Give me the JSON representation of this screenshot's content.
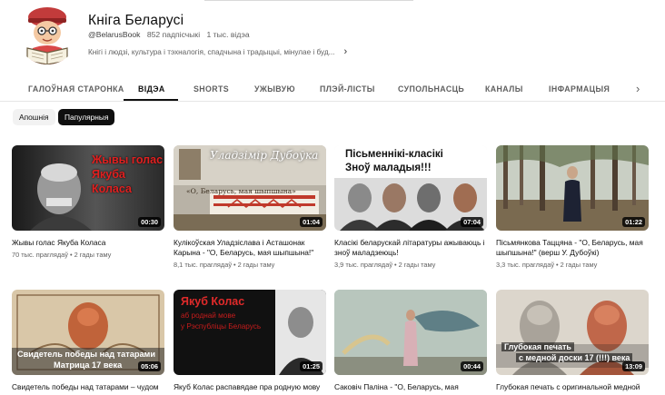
{
  "channel": {
    "name": "Кніга Беларусі",
    "handle": "@BelarusBook",
    "subscribers": "852 падпісчыкі",
    "videos_count": "1 тыс. відэа",
    "description": "Кнігі і людзі, культура і тэхналогія, спадчына і традыцыі, мінулае і буд..."
  },
  "tabs": [
    {
      "label": "ГАЛОЎНАЯ СТАРОНКА"
    },
    {
      "label": "ВІДЭА"
    },
    {
      "label": "SHORTS"
    },
    {
      "label": "УЖЫВУЮ"
    },
    {
      "label": "ПЛЭЙ-ЛІСТЫ"
    },
    {
      "label": "СУПОЛЬНАСЦЬ"
    },
    {
      "label": "КАНАЛЫ"
    },
    {
      "label": "ІНФАРМАЦЫЯ"
    }
  ],
  "active_tab": "ВІДЭА",
  "chips": {
    "newest": "Апошнія",
    "popular": "Папулярныя",
    "selected": "Папулярныя"
  },
  "videos": [
    {
      "title": "Жывы голас Якуба Коласа",
      "views": "70 тыс. праглядаў",
      "age": "2 гады таму",
      "duration": "00:30",
      "thumb_text": [
        "Жывы голас",
        "Якуба Коласа"
      ]
    },
    {
      "title": "Кулікоўская Уладзіслава і Асташонак Карына - \"О, Беларусь, мая шыпшына!\"",
      "views": "8,1 тыс. праглядаў",
      "age": "2 гады таму",
      "duration": "01:04",
      "thumb_text": [
        "Уладзімір Дубоўка",
        "«О, Беларусь, мая шыпшына»"
      ]
    },
    {
      "title": "Класікі беларускай літаратуры ажываюць і зноў маладзеюць!",
      "views": "3,9 тыс. праглядаў",
      "age": "2 гады таму",
      "duration": "07:04",
      "thumb_text": [
        "Пісьменнікі-класікі",
        "Зноў маладыя!!!"
      ]
    },
    {
      "title": "Пісьмянкова Таццяна - \"О, Беларусь, мая шыпшына!\" (верш У. Дубоўкі)",
      "views": "3,3 тыс. праглядаў",
      "age": "2 гады таму",
      "duration": "01:22",
      "thumb_text": []
    },
    {
      "title": "Свидетель победы над татарами – чудом уцелевшая",
      "views": "",
      "age": "",
      "duration": "05:06",
      "thumb_text": [
        "Свидетель победы над татарами",
        "Матрица 17 века"
      ]
    },
    {
      "title": "Якуб Колас распавядае пра родную мову",
      "views": "",
      "age": "",
      "duration": "01:25",
      "thumb_text": [
        "Якуб Колас",
        "аб роднай мове",
        "у Рэспубліцы Беларусь"
      ]
    },
    {
      "title": "Саковіч Паліна - \"О, Беларусь, мая",
      "views": "",
      "age": "",
      "duration": "00:44",
      "thumb_text": []
    },
    {
      "title": "Глубокая печать с оригинальной медной",
      "views": "",
      "age": "",
      "duration": "13:09",
      "thumb_text": [
        "Глубокая печать",
        "с медной доски 17 (!!!) века"
      ]
    }
  ],
  "colors": {
    "accent_text": "#0f0f0f",
    "secondary_text": "#606060",
    "chip_selected_bg": "#0f0f0f",
    "chip_bg": "#f2f2f2",
    "thumb_red": "#c8102e"
  }
}
